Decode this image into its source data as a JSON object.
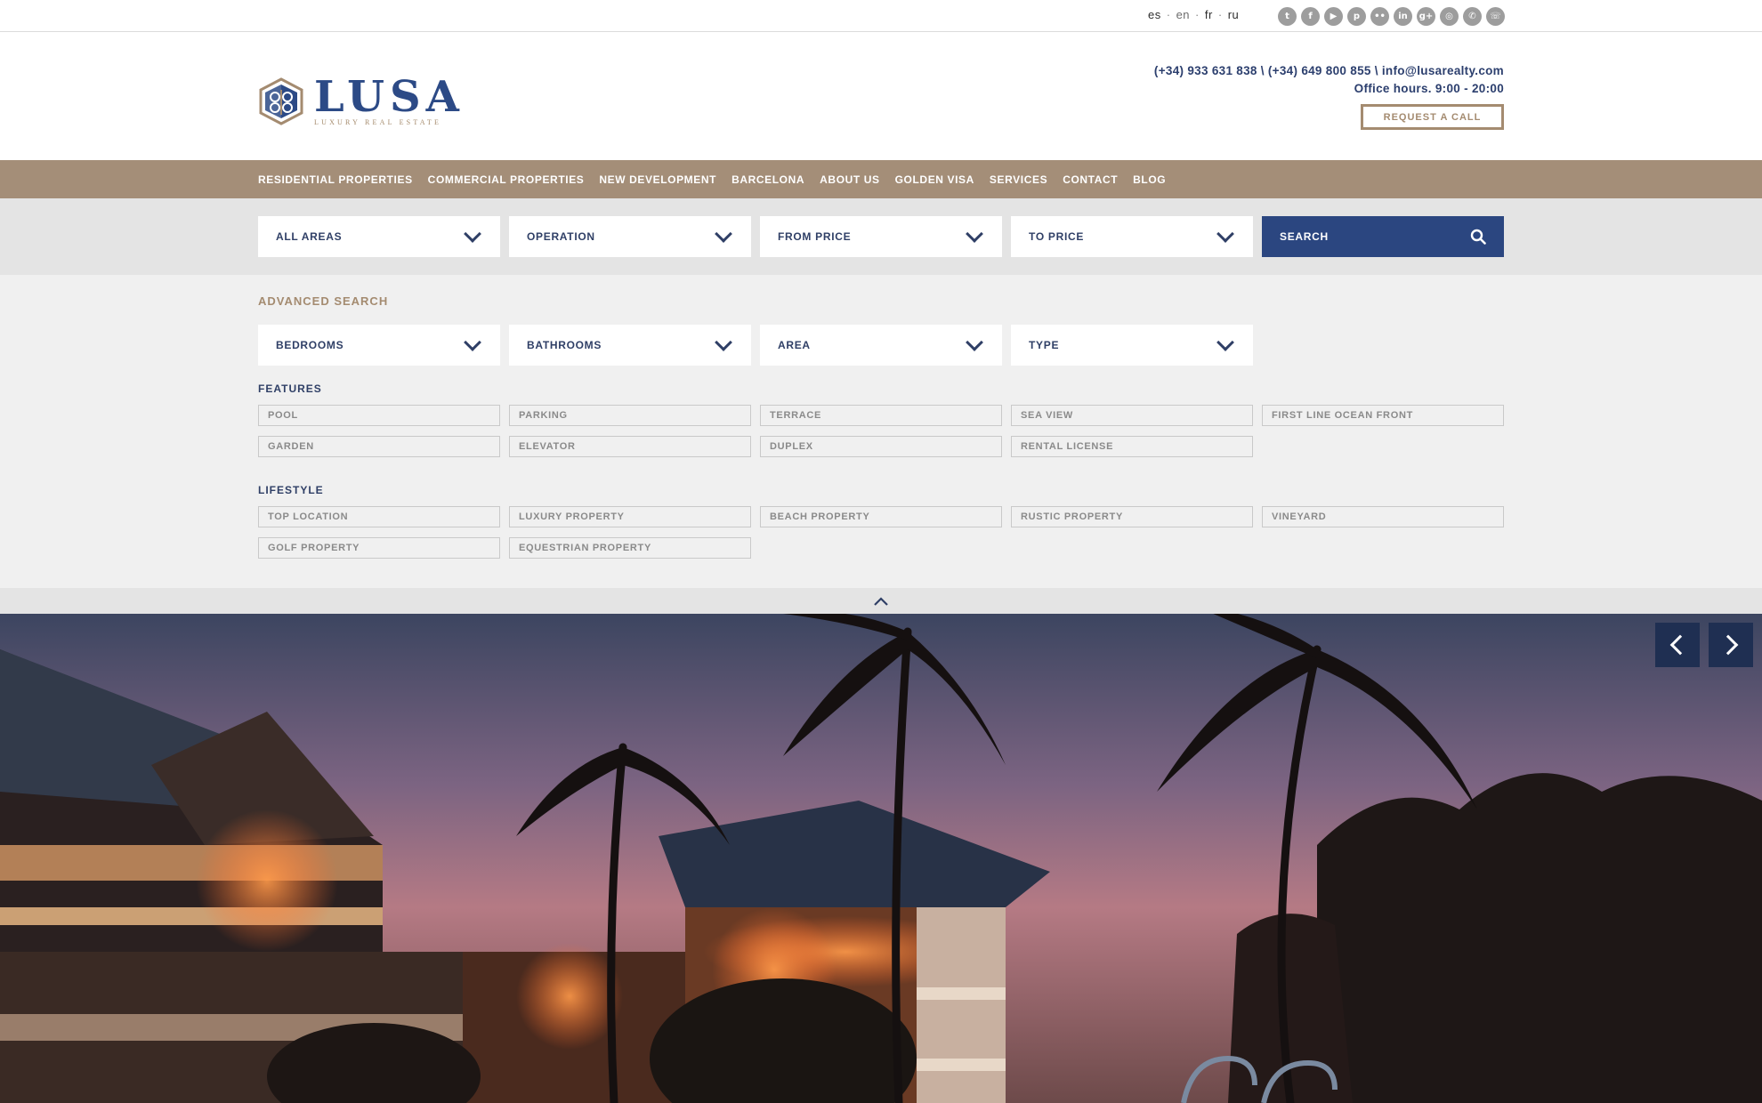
{
  "languages": [
    "es",
    "en",
    "fr",
    "ru"
  ],
  "social_icons": [
    {
      "name": "twitter-icon",
      "glyph": "t"
    },
    {
      "name": "facebook-icon",
      "glyph": "f"
    },
    {
      "name": "youtube-icon",
      "glyph": "▶"
    },
    {
      "name": "pinterest-icon",
      "glyph": "p"
    },
    {
      "name": "flickr-icon",
      "glyph": "••"
    },
    {
      "name": "linkedin-icon",
      "glyph": "in"
    },
    {
      "name": "google-plus-icon",
      "glyph": "g+"
    },
    {
      "name": "instagram-icon",
      "glyph": "◎"
    },
    {
      "name": "whatsapp-icon",
      "glyph": "✆"
    },
    {
      "name": "phone-icon",
      "glyph": "☏"
    }
  ],
  "brand": {
    "name": "LUSA",
    "tagline": "LUXURY REAL ESTATE"
  },
  "contact": {
    "phones_email": "(+34) 933 631 838 \\ (+34) 649 800 855 \\ info@lusarealty.com",
    "hours": "Office hours. 9:00 - 20:00",
    "request_call": "REQUEST A CALL"
  },
  "nav": [
    "RESIDENTIAL PROPERTIES",
    "COMMERCIAL PROPERTIES",
    "NEW DEVELOPMENT",
    "BARCELONA",
    "ABOUT US",
    "GOLDEN VISA",
    "SERVICES",
    "CONTACT",
    "BLOG"
  ],
  "search": {
    "areas": "ALL AREAS",
    "operation": "OPERATION",
    "from_price": "FROM PRICE",
    "to_price": "TO PRICE",
    "button": "SEARCH"
  },
  "advanced": {
    "title": "ADVANCED SEARCH",
    "bedrooms": "BEDROOMS",
    "bathrooms": "BATHROOMS",
    "area": "AREA",
    "type": "TYPE"
  },
  "features": {
    "title": "FEATURES",
    "items": [
      "POOL",
      "PARKING",
      "TERRACE",
      "SEA VIEW",
      "FIRST LINE OCEAN FRONT",
      "GARDEN",
      "ELEVATOR",
      "DUPLEX",
      "RENTAL LICENSE"
    ]
  },
  "lifestyle": {
    "title": "LIFESTYLE",
    "items": [
      "TOP LOCATION",
      "LUXURY PROPERTY",
      "BEACH PROPERTY",
      "RUSTIC PROPERTY",
      "VINEYARD",
      "GOLF PROPERTY",
      "EQUESTRIAN PROPERTY"
    ]
  },
  "colors": {
    "brand_blue": "#2b4680",
    "nav_taupe": "#a48e78",
    "accent_gold": "#a48b70"
  }
}
